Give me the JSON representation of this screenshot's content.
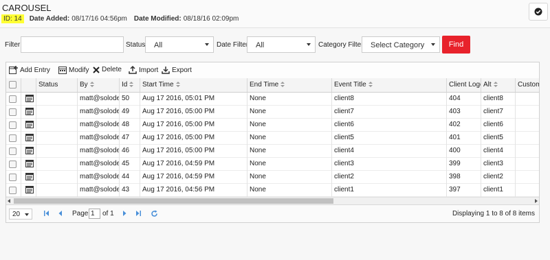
{
  "header": {
    "title": "CAROUSEL",
    "id_label": "ID: 14",
    "date_added_label": "Date Added:",
    "date_added": "08/17/16 04:56pm",
    "date_modified_label": "Date Modified:",
    "date_modified": "08/18/16 02:09pm",
    "check_icon": "check-circle-icon"
  },
  "filters": {
    "filter_label": "Filter",
    "filter_value": "",
    "status_label": "Status",
    "status_value": "All",
    "date_filter_label": "Date Filter",
    "date_filter_value": "All",
    "category_filter_label": "Category Filter",
    "category_value": "Select Category",
    "find_label": "Find",
    "find_color": "#e8222b"
  },
  "toolbar": {
    "add": "Add Entry",
    "modify": "Modify",
    "delete": "Delete",
    "import": "Import",
    "export": "Export"
  },
  "columns": [
    "Status",
    "By",
    "Id",
    "Start Time",
    "End Time",
    "Event Title",
    "Client Logo",
    "Alt",
    "Custom"
  ],
  "rows": [
    {
      "by": "matt@solodev",
      "id": "50",
      "start": "Aug 17 2016, 05:01 PM",
      "end": "None",
      "title": "client8",
      "logo": "404",
      "alt": "client8"
    },
    {
      "by": "matt@solodev",
      "id": "49",
      "start": "Aug 17 2016, 05:00 PM",
      "end": "None",
      "title": "client7",
      "logo": "403",
      "alt": "client7"
    },
    {
      "by": "matt@solodev",
      "id": "48",
      "start": "Aug 17 2016, 05:00 PM",
      "end": "None",
      "title": "client6",
      "logo": "402",
      "alt": "client6"
    },
    {
      "by": "matt@solodev",
      "id": "47",
      "start": "Aug 17 2016, 05:00 PM",
      "end": "None",
      "title": "client5",
      "logo": "401",
      "alt": "client5"
    },
    {
      "by": "matt@solodev",
      "id": "46",
      "start": "Aug 17 2016, 05:00 PM",
      "end": "None",
      "title": "client4",
      "logo": "400",
      "alt": "client4"
    },
    {
      "by": "matt@solodev",
      "id": "45",
      "start": "Aug 17 2016, 04:59 PM",
      "end": "None",
      "title": "client3",
      "logo": "399",
      "alt": "client3"
    },
    {
      "by": "matt@solodev",
      "id": "44",
      "start": "Aug 17 2016, 04:59 PM",
      "end": "None",
      "title": "client2",
      "logo": "398",
      "alt": "client2"
    },
    {
      "by": "matt@solodev",
      "id": "43",
      "start": "Aug 17 2016, 04:56 PM",
      "end": "None",
      "title": "client1",
      "logo": "397",
      "alt": "client1"
    }
  ],
  "pager": {
    "page_size": "20",
    "page_label": "Page",
    "page_value": "1",
    "of_label": "of 1",
    "info": "Displaying 1 to 8 of 8 items"
  }
}
